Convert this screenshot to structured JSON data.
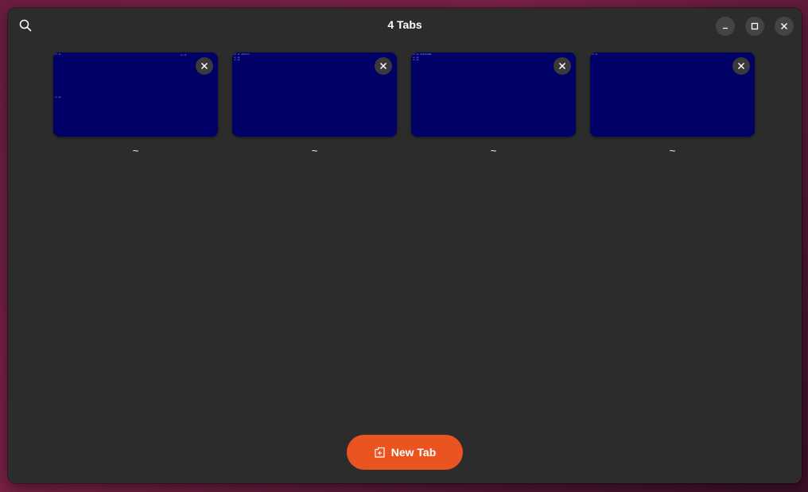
{
  "header": {
    "title": "4 Tabs",
    "search_icon": "search-icon",
    "minimize_icon": "minimize-icon",
    "maximize_icon": "maximize-icon",
    "close_icon": "close-icon"
  },
  "tabs": [
    {
      "label": "~",
      "term_lines": "u:~$ ",
      "term_right": "u:~$ ",
      "term_low": "u:~$ ",
      "close_icon": "close-icon"
    },
    {
      "label": "~",
      "term_lines": "u:~$ ubuntu\nu:~$\nu:~$ ",
      "term_right": "",
      "term_low": "",
      "close_icon": "close-icon"
    },
    {
      "label": "~",
      "term_lines": "u:~$ hostname\nu:~$\nu:~$ ",
      "term_right": "",
      "term_low": "",
      "close_icon": "close-icon"
    },
    {
      "label": "~",
      "term_lines": "u:~$ ",
      "term_right": "",
      "term_low": "",
      "close_icon": "close-icon"
    }
  ],
  "new_tab": {
    "label": "New Tab",
    "icon": "tab-new-icon"
  },
  "colors": {
    "window_bg": "#2c2c2c",
    "thumbnail_bg": "#010066",
    "accent": "#e95420",
    "text": "#ffffff",
    "button_bg": "#444444"
  }
}
